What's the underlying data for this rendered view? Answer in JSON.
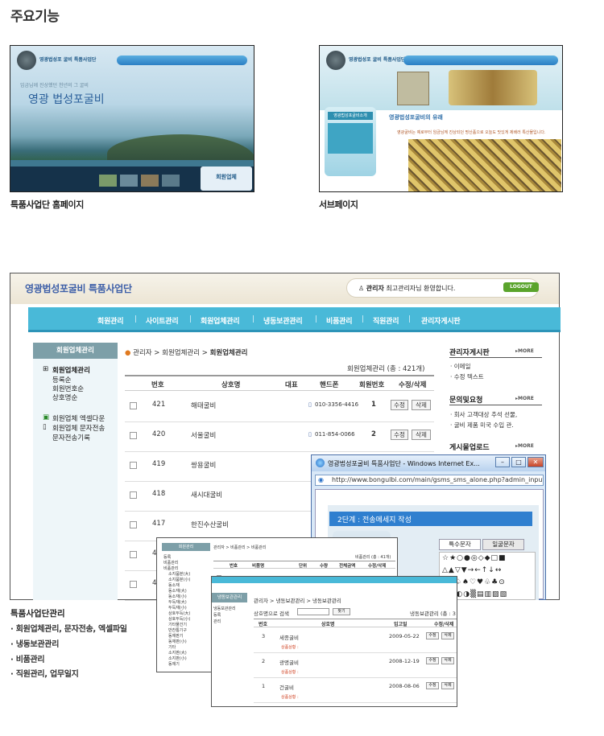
{
  "page": {
    "title": "주요기능"
  },
  "thumbs": {
    "home": {
      "caption": "특품사업단 홈페이지",
      "brand": "영광법성포 굴비 특품사업단",
      "slogan": "임금님께 진상했던 천년의 그 굴비",
      "hero": "영광 법성포굴비",
      "card": "회원업체"
    },
    "sub": {
      "caption": "서브페이지",
      "brand": "영광법성포 굴비 특품사업단",
      "side_title": "영광법성포굴비소개",
      "title": "영광법성포굴비의 유래",
      "text": "영광굴비는 예로부터 임금님께 진상되던 명산품으로 오늘도 맛있게 제배러 특산물입니다."
    }
  },
  "admin": {
    "header_title": "영광법성포굴비 특품사업단",
    "welcome_role": "관리자",
    "welcome_text": "최고관리자님 환영합니다.",
    "logout": "LOGOUT",
    "menu": [
      "회원관리",
      "사이트관리",
      "회원업체관리",
      "냉동보관관리",
      "비품관리",
      "직원관리",
      "관리자게시판"
    ],
    "sidebar": {
      "header": "회원업체관리",
      "items": [
        "회원업체관리",
        "등록순",
        "회원번호순",
        "상호명순",
        "회원업체 엑셀다운",
        "회원업체 문자전송",
        "문자전송기록"
      ]
    },
    "breadcrumb": {
      "home": "관리자",
      "sep": ">",
      "parent": "회원업체관리",
      "current": "회원업체관리"
    },
    "total": "회원업체관리 (총 : 421개)",
    "table": {
      "headers": [
        "번호",
        "상호명",
        "대표",
        "핸드폰",
        "회원번호",
        "수정/삭제"
      ],
      "rows": [
        {
          "no": "421",
          "name": "해태굴비",
          "phone": "010-3356-4416",
          "member": "1"
        },
        {
          "no": "420",
          "name": "서울굴비",
          "phone": "011-854-0066",
          "member": "2"
        },
        {
          "no": "419",
          "name": "쌍용굴비",
          "phone": "",
          "member": ""
        },
        {
          "no": "418",
          "name": "새시대굴비",
          "phone": "",
          "member": ""
        },
        {
          "no": "417",
          "name": "한진수산굴비",
          "phone": "",
          "member": ""
        },
        {
          "no": "4",
          "name": "",
          "phone": "",
          "member": ""
        },
        {
          "no": "4",
          "name": "",
          "phone": "",
          "member": ""
        }
      ],
      "edit": "수정",
      "delete": "삭제"
    },
    "right": {
      "board_title": "관리자게시판",
      "board_items": [
        "이메일",
        "수정 텍스트"
      ],
      "qna_title": "문의및요청",
      "qna_items": [
        "회사 고객대상 추석 선물,",
        "굴비 제품 미국 수입 관."
      ],
      "download_title": "게시물업로드",
      "more": "MORE"
    }
  },
  "popup": {
    "title": "영광법성포굴비 특품사업단 - Windows Internet Ex...",
    "url": "http://www.bongulbi.com/main/gsms_sms_alone.php?admin_input_li",
    "step": "2단계 : 전송메세지 작성",
    "tab1": "특수문자",
    "tab2": "일굴문자",
    "symbols": [
      "☆★○●◎◇◆□■",
      "△▲▽▼→←↑↓↔",
      "▷▶♤♠♡♥♧♣⊙",
      "◈▣◐◑▒▤▥▨▧"
    ]
  },
  "overlay1": {
    "sidebar_header": "회원관리",
    "crumb": "관리자 > 비품관리 > 비품관리",
    "total": "비품관리 (총 : 41개)",
    "headers": [
      "번호",
      "비품명",
      "단위",
      "수량",
      "전체금액",
      "수정/삭제"
    ],
    "side_items": [
      "등록",
      "비품관리",
      "비품관리",
      "소지품분(大)",
      "소지품분(小)",
      "동소재",
      "동소재(大)",
      "동소재(小)",
      "두득재(大)",
      "두득재(小)",
      "상호두득(大)",
      "상호두득(小)",
      "기타물건기",
      "반찬통기구",
      "동재판기",
      "동재판(小)",
      "기타",
      "소지판(大)",
      "소지판(小)",
      "동재기"
    ]
  },
  "overlay2": {
    "sidebar_header": "냉동보관관리",
    "side_items": [
      "냉동보관관리",
      "등록",
      "관리"
    ],
    "crumb": "관리자 > 냉동보관관리 > 냉동보관관리",
    "search_label": "상호명으로 검색",
    "search_btn": "찾기",
    "total": "냉동보관관리 (총 : 3",
    "headers": [
      "번호",
      "상호명",
      "입고일",
      "수정/삭제"
    ],
    "rows": [
      {
        "no": "3",
        "name": "세종굴비",
        "date": "2009-05-22",
        "status": "상품상황 :"
      },
      {
        "no": "2",
        "name": "광명굴비",
        "date": "2008-12-19",
        "status": "상품상황 :"
      },
      {
        "no": "1",
        "name": "건굴비",
        "date": "2008-08-06",
        "status": "상품상황 :"
      }
    ],
    "edit": "수정",
    "delete": "삭제"
  },
  "features": {
    "title": "특품사업단관리",
    "items": [
      "회원업체관리, 문자전송, 엑셀파일",
      "냉동보관관리",
      "비품관리",
      "직원관리, 업무일지"
    ]
  }
}
